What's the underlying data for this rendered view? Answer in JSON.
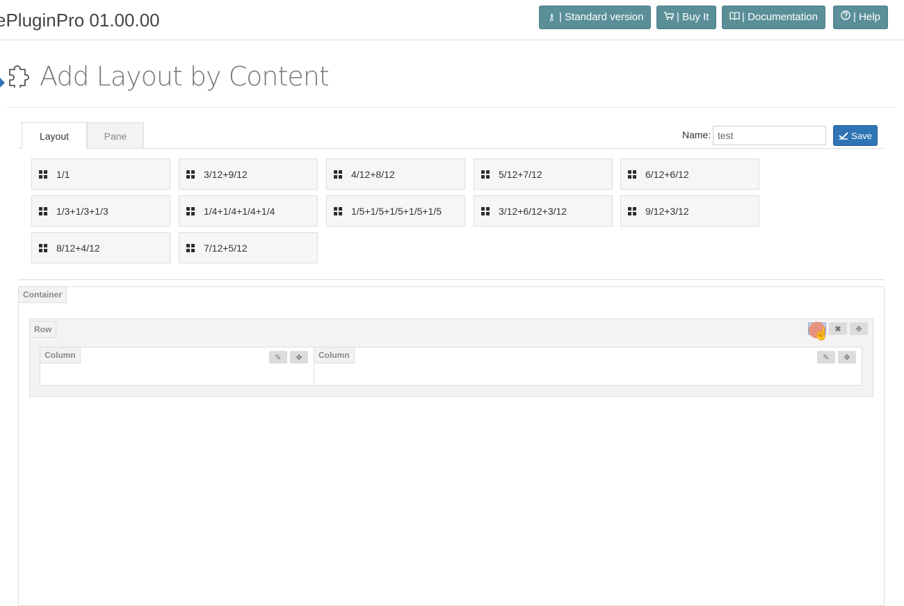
{
  "header": {
    "app_title": "ePluginPro 01.00.00",
    "buttons": [
      {
        "icon": "key-icon",
        "label": "| Standard version"
      },
      {
        "icon": "cart-icon",
        "label": "| Buy It"
      },
      {
        "icon": "book-icon",
        "label": "| Documentation"
      },
      {
        "icon": "help-icon",
        "label": "| Help"
      }
    ],
    "button_color": "#5a8f98"
  },
  "page": {
    "title": "Add Layout by Content",
    "icon": "puzzle-icon"
  },
  "tabs": [
    {
      "label": "Layout",
      "active": true
    },
    {
      "label": "Pane",
      "active": false
    }
  ],
  "form": {
    "name_label": "Name:",
    "name_value": "test",
    "save_label": "Save",
    "save_color": "#2f74b5"
  },
  "presets": [
    "1/1",
    "3/12+9/12",
    "4/12+8/12",
    "5/12+7/12",
    "6/12+6/12",
    "1/3+1/3+1/3",
    "1/4+1/4+1/4+1/4",
    "1/5+1/5+1/5+1/5+1/5",
    "3/12+6/12+3/12",
    "9/12+3/12",
    "8/12+4/12",
    "7/12+5/12"
  ],
  "builder": {
    "container_label": "Container",
    "row_label": "Row",
    "columns": [
      {
        "label": "Column"
      },
      {
        "label": "Column"
      }
    ]
  }
}
